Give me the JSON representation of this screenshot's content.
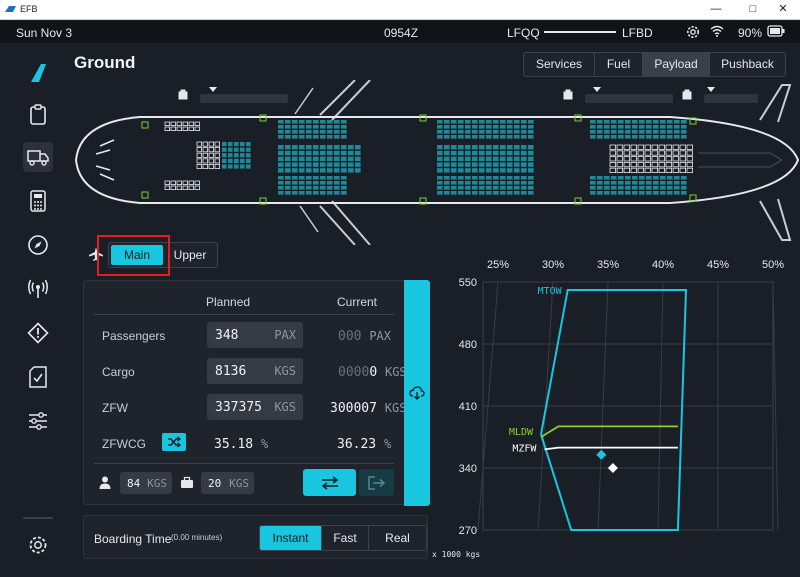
{
  "window": {
    "title": "EFB"
  },
  "status": {
    "date": "Sun Nov 3",
    "time": "0954Z",
    "origin": "LFQQ",
    "destination": "LFBD",
    "battery": "90%"
  },
  "sidebar": {
    "items": [
      {
        "name": "logo"
      },
      {
        "name": "clipboard"
      },
      {
        "name": "ground",
        "active": true
      },
      {
        "name": "calculator"
      },
      {
        "name": "compass"
      },
      {
        "name": "antenna"
      },
      {
        "name": "warning"
      },
      {
        "name": "checklist"
      },
      {
        "name": "sliders"
      },
      {
        "name": "settings"
      }
    ]
  },
  "page": {
    "title": "Ground"
  },
  "tabs": [
    {
      "label": "Services",
      "active": false
    },
    {
      "label": "Fuel",
      "active": false
    },
    {
      "label": "Payload",
      "active": true
    },
    {
      "label": "Pushback",
      "active": false
    }
  ],
  "deck": {
    "main_label": "Main",
    "upper_label": "Upper",
    "selected": "Main"
  },
  "payload": {
    "planned_header": "Planned",
    "current_header": "Current",
    "passengers": {
      "label": "Passengers",
      "planned": "348",
      "unit": "PAX",
      "current_dim": "000",
      "current_unit": "PAX"
    },
    "cargo": {
      "label": "Cargo",
      "planned": "8136",
      "unit": "KGS",
      "current_dim": "0000",
      "current_bright": "0",
      "current_unit": "KGS"
    },
    "zfw": {
      "label": "ZFW",
      "planned": "337375",
      "unit": "KGS",
      "current": "300007",
      "current_unit": "KGS"
    },
    "zfwcg": {
      "label": "ZFWCG",
      "planned": "35.18",
      "current": "36.23",
      "unit": "%"
    },
    "pax_weight": {
      "value": "84",
      "unit": "KGS"
    },
    "bag_weight": {
      "value": "20",
      "unit": "KGS"
    }
  },
  "boarding": {
    "label": "Boarding Time",
    "sublabel": "(0.00 minutes)",
    "options": [
      {
        "label": "Instant",
        "active": true
      },
      {
        "label": "Fast",
        "active": false
      },
      {
        "label": "Real",
        "active": false
      }
    ]
  },
  "colors": {
    "accent": "#18c6e0",
    "mldw": "#8ccf2e",
    "background": "#1a1e26",
    "panel": "#1f232b"
  },
  "chart_data": {
    "type": "line",
    "x_tick_labels": [
      "25%",
      "30%",
      "35%",
      "40%",
      "45%",
      "50%"
    ],
    "y_tick_labels": [
      "550",
      "480",
      "410",
      "340",
      "270"
    ],
    "xlim": [
      25,
      50
    ],
    "ylim": [
      270,
      550
    ],
    "x_unit_label": "x 1000 kgs",
    "grid": true,
    "series": [
      {
        "name": "MTOW",
        "color": "#18c6e0",
        "points": [
          [
            30,
            378
          ],
          [
            32.3,
            541
          ],
          [
            42.5,
            541
          ],
          [
            41.8,
            270
          ],
          [
            32.6,
            270
          ],
          [
            30,
            378
          ]
        ]
      },
      {
        "name": "MLDW",
        "color": "#8ccf2e",
        "points": [
          [
            30,
            375
          ],
          [
            31.5,
            387
          ],
          [
            41.8,
            387
          ]
        ]
      },
      {
        "name": "MZFW",
        "color": "#ffffff",
        "points": [
          [
            30.3,
            361
          ],
          [
            31.5,
            363
          ],
          [
            41.8,
            363
          ]
        ]
      }
    ],
    "markers": [
      {
        "name": "planned",
        "color": "#18c6e0",
        "x": 35.2,
        "y": 355
      },
      {
        "name": "current",
        "color": "#ffffff",
        "x": 36.2,
        "y": 340
      }
    ]
  }
}
